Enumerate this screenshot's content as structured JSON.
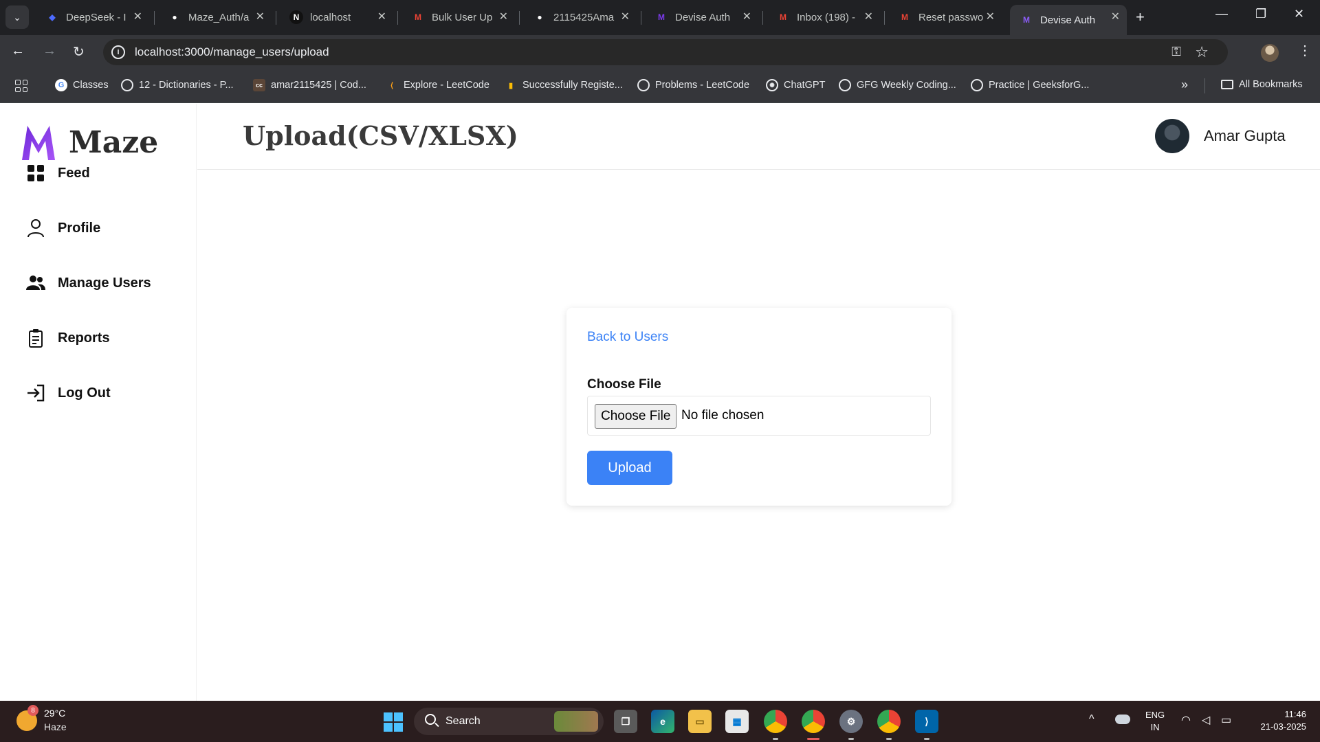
{
  "browser": {
    "tabs": [
      {
        "label": "DeepSeek - I",
        "icon": "deepseek-icon",
        "color": "#4d6bfe"
      },
      {
        "label": "Maze_Auth/a",
        "icon": "github-icon",
        "color": "#ffffff"
      },
      {
        "label": "localhost",
        "icon": "nextjs-icon",
        "color": "#ffffff"
      },
      {
        "label": "Bulk User Up",
        "icon": "gmail-icon",
        "color": "#ea4335"
      },
      {
        "label": "2115425Ama",
        "icon": "github-icon",
        "color": "#ffffff"
      },
      {
        "label": "Devise Auth",
        "icon": "maze-icon",
        "color": "#7c3aed"
      },
      {
        "label": "Inbox (198) -",
        "icon": "gmail-icon",
        "color": "#ea4335"
      },
      {
        "label": "Reset passwo",
        "icon": "gmail-icon",
        "color": "#ea4335"
      },
      {
        "label": "Devise Auth",
        "icon": "maze-icon",
        "color": "#7c3aed",
        "active": true
      }
    ],
    "url": "localhost:3000/manage_users/upload",
    "bookmarks": [
      {
        "label": "Classes",
        "icon": "google-icon"
      },
      {
        "label": "12 - Dictionaries - P...",
        "icon": "globe-icon"
      },
      {
        "label": "amar2115425 | Cod...",
        "icon": "codechef-icon"
      },
      {
        "label": "Explore - LeetCode",
        "icon": "leetcode-icon"
      },
      {
        "label": "Successfully Registe...",
        "icon": "chart-icon"
      },
      {
        "label": "Problems - LeetCode",
        "icon": "globe-icon"
      },
      {
        "label": "ChatGPT",
        "icon": "openai-icon"
      },
      {
        "label": "GFG Weekly Coding...",
        "icon": "globe-icon"
      },
      {
        "label": "Practice | GeeksforG...",
        "icon": "globe-icon"
      }
    ],
    "all_bookmarks_label": "All Bookmarks"
  },
  "app": {
    "brand": "Maze",
    "page_title": "Upload(CSV/XLSX)",
    "user_name": "Amar Gupta",
    "nav": [
      {
        "label": "Feed",
        "icon": "grid-icon"
      },
      {
        "label": "Profile",
        "icon": "user-icon"
      },
      {
        "label": "Manage Users",
        "icon": "users-icon"
      },
      {
        "label": "Reports",
        "icon": "clipboard-icon"
      },
      {
        "label": "Log Out",
        "icon": "logout-icon"
      }
    ],
    "accent_color": "#3b82f6"
  },
  "upload_form": {
    "back_link": "Back to Users",
    "field_label": "Choose File",
    "file_button": "Choose File",
    "file_status": "No file chosen",
    "submit_label": "Upload"
  },
  "taskbar": {
    "weather_temp": "29°C",
    "weather_desc": "Haze",
    "weather_badge": "8",
    "search_label": "Search",
    "lang_top": "ENG",
    "lang_bottom": "IN",
    "time": "11:46",
    "date": "21-03-2025"
  }
}
